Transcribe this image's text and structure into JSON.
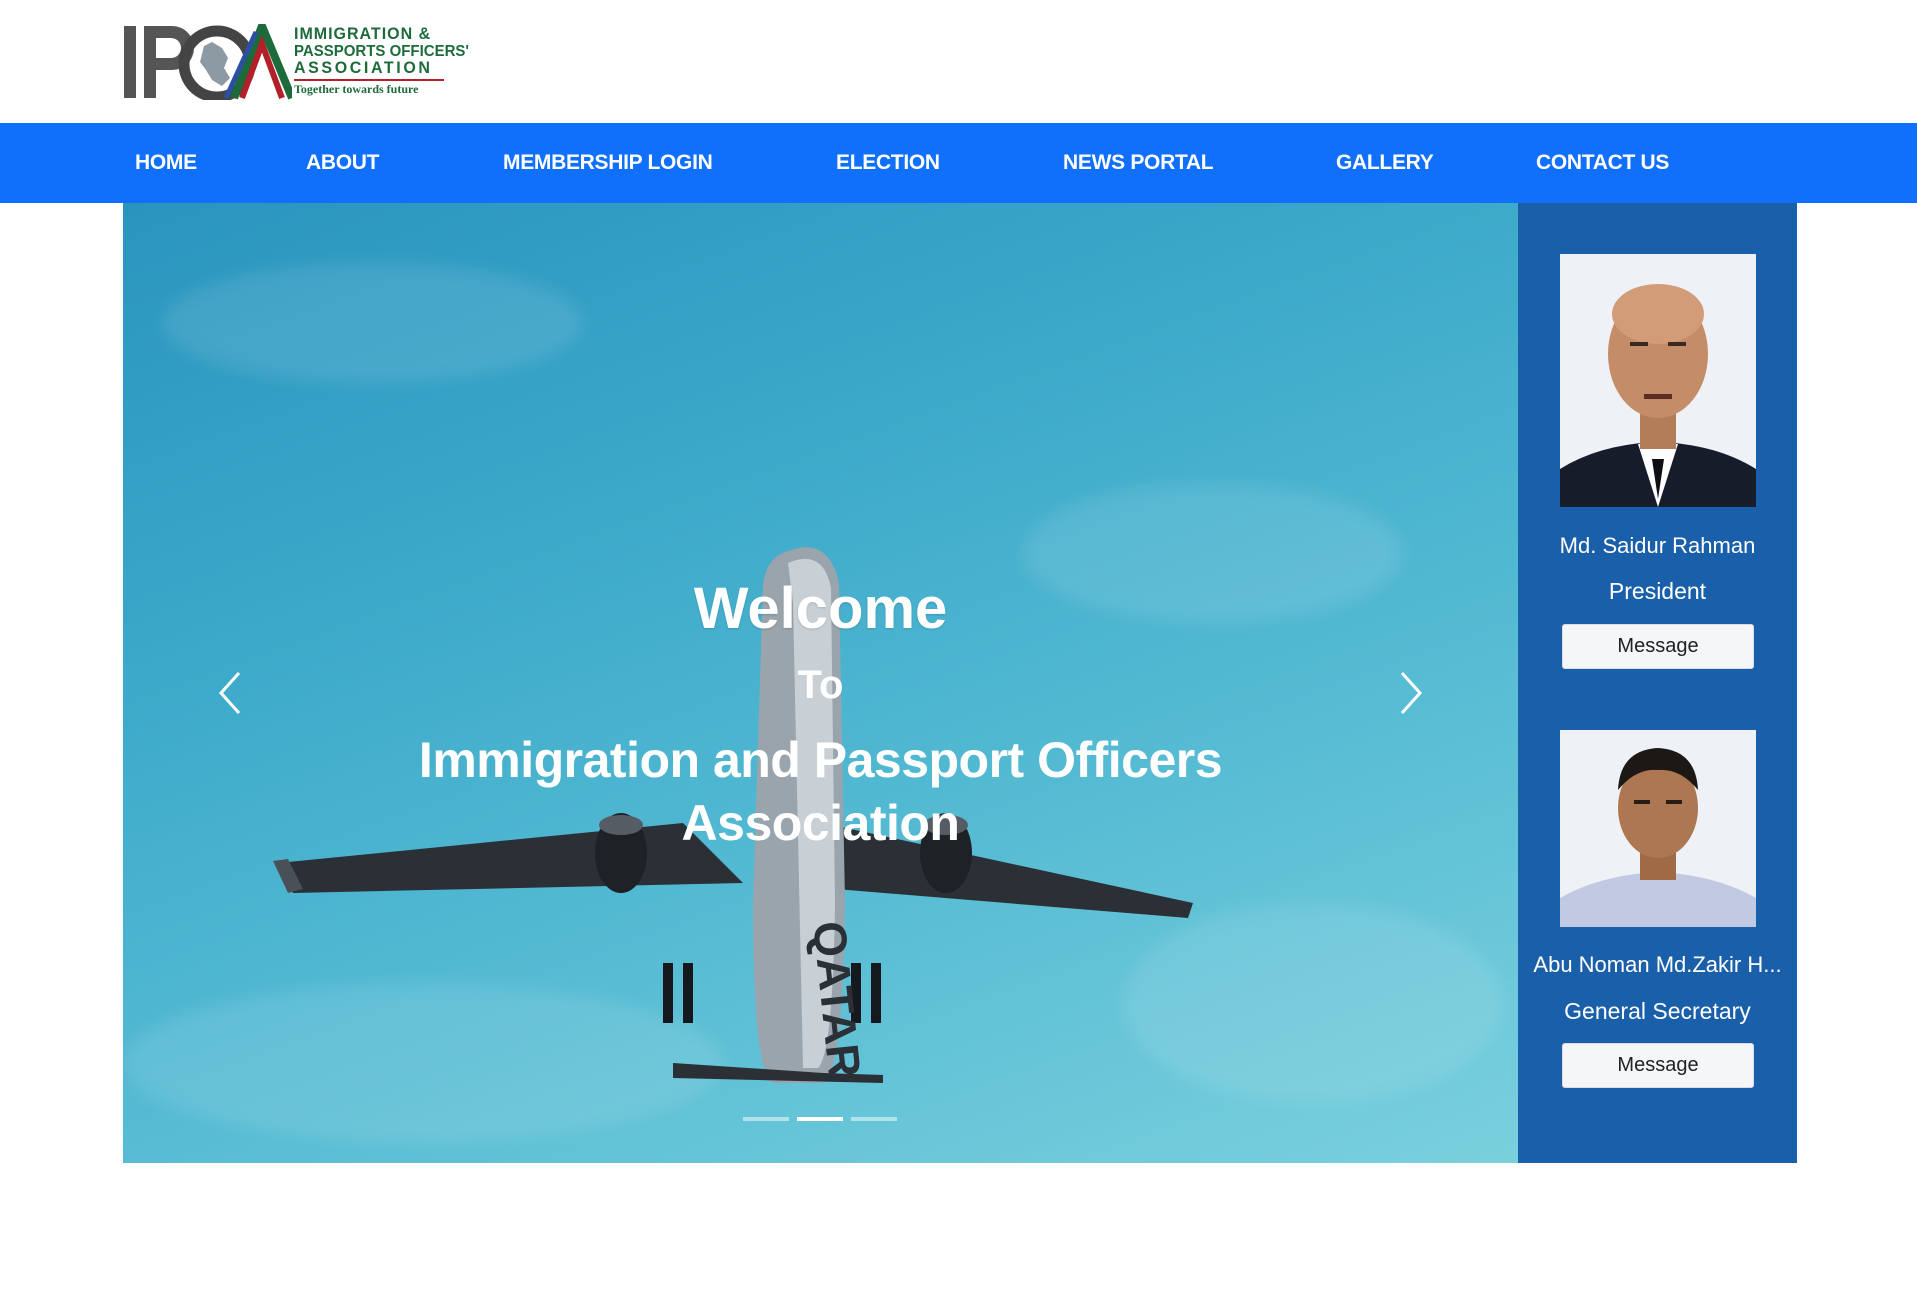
{
  "logo": {
    "mark": "IPOA",
    "line1": "IMMIGRATION &",
    "line2": "PASSPORTS OFFICERS'",
    "line3": "ASSOCIATION",
    "tagline": "Together towards future"
  },
  "nav": {
    "items": [
      "HOME",
      "ABOUT",
      "MEMBERSHIP LOGIN",
      "ELECTION",
      "NEWS PORTAL",
      "GALLERY",
      "CONTACT US"
    ]
  },
  "hero": {
    "welcome": "Welcome",
    "to": "To",
    "name": "Immigration and Passport Officers Association",
    "plane_text": "QATAR",
    "active_slide": 2,
    "slide_count": 3
  },
  "leaders": [
    {
      "name": "Md. Saidur Rahman",
      "role": "President",
      "button": "Message"
    },
    {
      "name": "Abu Noman Md.Zakir H...",
      "role": "General Secretary",
      "button": "Message"
    }
  ],
  "colors": {
    "nav": "#1070fb",
    "side": "#1a5fa9",
    "brand_green": "#1d6b3a",
    "brand_red": "#b3202a"
  }
}
